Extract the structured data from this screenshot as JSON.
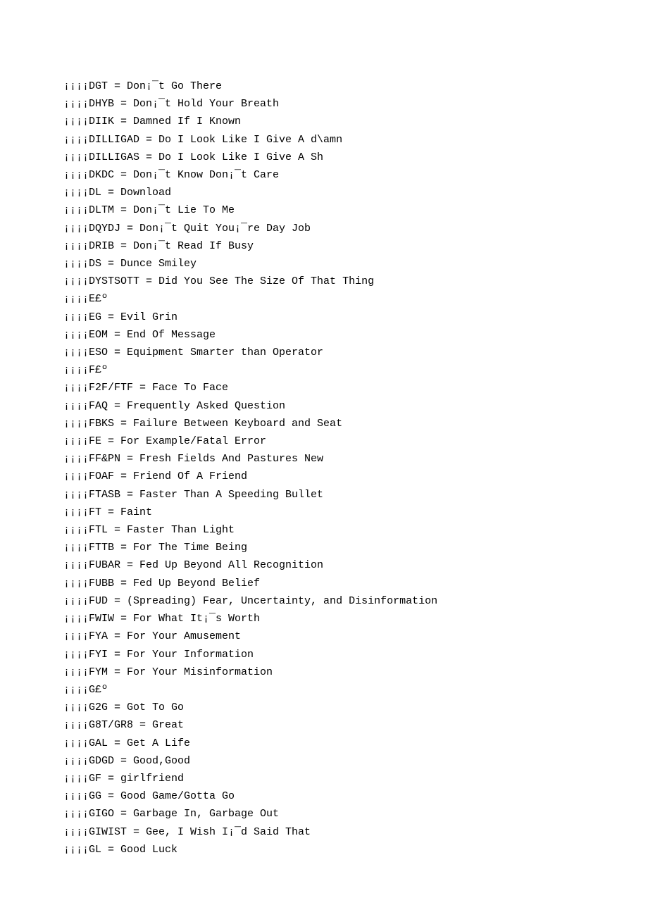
{
  "lines": [
    "¡¡¡¡DGT = Don¡¯t Go There",
    "¡¡¡¡DHYB = Don¡¯t Hold Your Breath",
    "¡¡¡¡DIIK = Damned If I Known",
    "¡¡¡¡DILLIGAD = Do I Look Like I Give A d\\amn",
    "¡¡¡¡DILLIGAS = Do I Look Like I Give A Sh",
    "¡¡¡¡DKDC = Don¡¯t Know Don¡¯t Care",
    "¡¡¡¡DL = Download",
    "¡¡¡¡DLTM = Don¡¯t Lie To Me",
    "¡¡¡¡DQYDJ = Don¡¯t Quit You¡¯re Day Job",
    "¡¡¡¡DRIB = Don¡¯t Read If Busy",
    "¡¡¡¡DS = Dunce Smiley",
    "¡¡¡¡DYSTSOTT = Did You See The Size Of That Thing",
    "¡¡¡¡E£º",
    "¡¡¡¡EG = Evil Grin",
    "¡¡¡¡EOM = End Of Message",
    "¡¡¡¡ESO = Equipment Smarter than Operator",
    "¡¡¡¡F£º",
    "¡¡¡¡F2F/FTF = Face To Face",
    "¡¡¡¡FAQ = Frequently Asked Question",
    "¡¡¡¡FBKS = Failure Between Keyboard and Seat",
    "¡¡¡¡FE = For Example/Fatal Error",
    "¡¡¡¡FF&PN = Fresh Fields And Pastures New",
    "¡¡¡¡FOAF = Friend Of A Friend",
    "¡¡¡¡FTASB = Faster Than A Speeding Bullet",
    "¡¡¡¡FT = Faint",
    "¡¡¡¡FTL = Faster Than Light",
    "¡¡¡¡FTTB = For The Time Being",
    "¡¡¡¡FUBAR = Fed Up Beyond All Recognition",
    "¡¡¡¡FUBB = Fed Up Beyond Belief",
    "¡¡¡¡FUD = (Spreading) Fear, Uncertainty, and Disinformation",
    "¡¡¡¡FWIW = For What It¡¯s Worth",
    "¡¡¡¡FYA = For Your Amusement",
    "¡¡¡¡FYI = For Your Information",
    "¡¡¡¡FYM = For Your Misinformation",
    "¡¡¡¡G£º",
    "¡¡¡¡G2G = Got To Go",
    "¡¡¡¡G8T/GR8 = Great",
    "¡¡¡¡GAL = Get A Life",
    "¡¡¡¡GDGD = Good,Good",
    "¡¡¡¡GF = girlfriend",
    "¡¡¡¡GG = Good Game/Gotta Go",
    "¡¡¡¡GIGO = Garbage In, Garbage Out",
    "¡¡¡¡GIWIST = Gee, I Wish I¡¯d Said That",
    "¡¡¡¡GL = Good Luck"
  ]
}
